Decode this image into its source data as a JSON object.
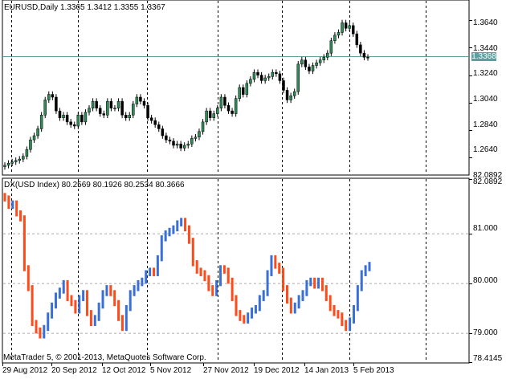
{
  "price_panel": {
    "title": "EURUSD,Daily  1.3365 1.3412 1.3355 1.3367",
    "axis_labels": [
      "1.3640",
      "1.3440",
      "1.3240",
      "1.3040",
      "1.2840",
      "1.2640"
    ],
    "current_price": "1.3368",
    "bottom_label": "82.0892"
  },
  "indicator_panel": {
    "title": "DX(USD Index)  80.2569 80.1926 80.2534 80.3666",
    "axis_labels": [
      "82.0892",
      "81.000",
      "80.000",
      "79.000",
      "78.4145"
    ],
    "copyright": "MetaTrader 5, © 2001-2013, MetaQuotes Software Corp."
  },
  "time_axis": [
    "29 Aug 2012",
    "20 Sep 2012",
    "12 Oct 2012",
    "5 Nov 2012",
    "27 Nov 2012",
    "19 Dec 2012",
    "14 Jan 2013",
    "5 Feb 2013"
  ],
  "colors": {
    "bull_candle": "#2e8b57",
    "bear_candle": "#000000",
    "bull_bar": "#3a6fd8",
    "bear_bar": "#ff4a1a",
    "current_price_line": "#5f9ea0"
  },
  "chart_data": [
    {
      "type": "candlestick",
      "symbol": "EURUSD",
      "timeframe": "Daily",
      "last_ohlc": {
        "open": 1.3365,
        "high": 1.3412,
        "low": 1.3355,
        "close": 1.3367
      },
      "ylim": [
        1.252,
        1.378
      ],
      "y_ticks": [
        1.264,
        1.284,
        1.304,
        1.324,
        1.344,
        1.364
      ],
      "current_price": 1.3368,
      "x_ticks": [
        "29 Aug 2012",
        "20 Sep 2012",
        "12 Oct 2012",
        "5 Nov 2012",
        "27 Nov 2012",
        "19 Dec 2012",
        "14 Jan 2013",
        "5 Feb 2013"
      ],
      "grid": true,
      "close_series": [
        1.2585,
        1.26,
        1.261,
        1.262,
        1.263,
        1.265,
        1.27,
        1.277,
        1.28,
        1.285,
        1.295,
        1.306,
        1.31,
        1.308,
        1.298,
        1.293,
        1.295,
        1.29,
        1.288,
        1.287,
        1.295,
        1.29,
        1.297,
        1.3,
        1.305,
        1.3,
        1.296,
        1.295,
        1.305,
        1.3,
        1.3,
        1.305,
        1.295,
        1.293,
        1.295,
        1.303,
        1.308,
        1.305,
        1.302,
        1.293,
        1.291,
        1.288,
        1.285,
        1.28,
        1.277,
        1.276,
        1.273,
        1.274,
        1.271,
        1.273,
        1.274,
        1.278,
        1.279,
        1.283,
        1.29,
        1.298,
        1.293,
        1.296,
        1.3,
        1.308,
        1.302,
        1.298,
        1.296,
        1.307,
        1.315,
        1.31,
        1.318,
        1.321,
        1.326,
        1.324,
        1.32,
        1.322,
        1.323,
        1.326,
        1.325,
        1.32,
        1.313,
        1.306,
        1.309,
        1.312,
        1.332,
        1.335,
        1.33,
        1.327,
        1.331,
        1.333,
        1.335,
        1.337,
        1.34,
        1.349,
        1.353,
        1.355,
        1.362,
        1.358,
        1.36,
        1.354,
        1.346,
        1.34,
        1.337,
        1.3367
      ]
    },
    {
      "type": "bar",
      "symbol": "DX (USD Index)",
      "last_ohlc": {
        "open": 80.2569,
        "high": 80.1926,
        "low": 80.2534,
        "close": 80.3666
      },
      "ylim": [
        78.4145,
        82.0892
      ],
      "y_ticks": [
        78.4145,
        79.0,
        80.0,
        81.0,
        82.0892
      ],
      "grid": true,
      "close_series": [
        81.7,
        81.55,
        81.6,
        81.4,
        81.3,
        80.3,
        79.9,
        79.2,
        79.05,
        78.95,
        79.1,
        79.35,
        79.55,
        79.75,
        79.85,
        80.0,
        79.7,
        79.6,
        79.45,
        79.7,
        79.8,
        79.4,
        79.2,
        79.3,
        79.55,
        79.8,
        79.9,
        79.8,
        79.6,
        79.3,
        79.1,
        79.5,
        79.8,
        79.9,
        80.0,
        80.05,
        80.2,
        80.25,
        80.2,
        80.5,
        80.9,
        81.0,
        81.05,
        81.1,
        81.2,
        81.25,
        81.1,
        80.85,
        80.4,
        80.25,
        80.2,
        80.1,
        79.9,
        79.8,
        80.0,
        80.3,
        80.25,
        80.05,
        79.7,
        79.4,
        79.3,
        79.25,
        79.35,
        79.45,
        79.5,
        79.7,
        79.8,
        80.2,
        80.5,
        80.35,
        80.25,
        79.9,
        79.65,
        79.45,
        79.55,
        79.7,
        79.8,
        80.0,
        80.05,
        79.95,
        80.05,
        79.9,
        79.7,
        79.5,
        79.4,
        79.35,
        79.2,
        79.1,
        79.25,
        79.5,
        79.9,
        80.2,
        80.3,
        80.3666
      ]
    }
  ]
}
